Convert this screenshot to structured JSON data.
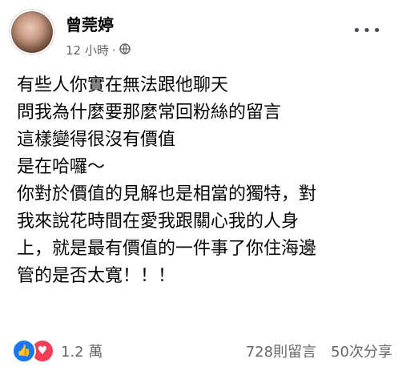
{
  "post": {
    "author": "曾莞婷",
    "time": "12 小時",
    "dot": "·",
    "lines": [
      "有些人你實在無法跟他聊天",
      "問我為什麼要那麼常回粉絲的留言",
      "這樣變得很沒有價值",
      "是在哈囉～",
      "你對於價值的見解也是相當的獨特，對",
      "我來說花時間在愛我跟關心我的人身",
      "上，就是最有價值的一件事了你住海邊",
      "管的是否太寬！！！"
    ]
  },
  "footer": {
    "reaction_count": "1.2 萬",
    "comments": "728則留言",
    "shares": "50次分享"
  },
  "icons": {
    "privacy": "globe-icon",
    "more": "more-icon",
    "like": "like-icon",
    "love": "love-icon"
  },
  "colors": {
    "like": "#1877f2",
    "love": "#f33e58",
    "meta": "#65676b"
  }
}
